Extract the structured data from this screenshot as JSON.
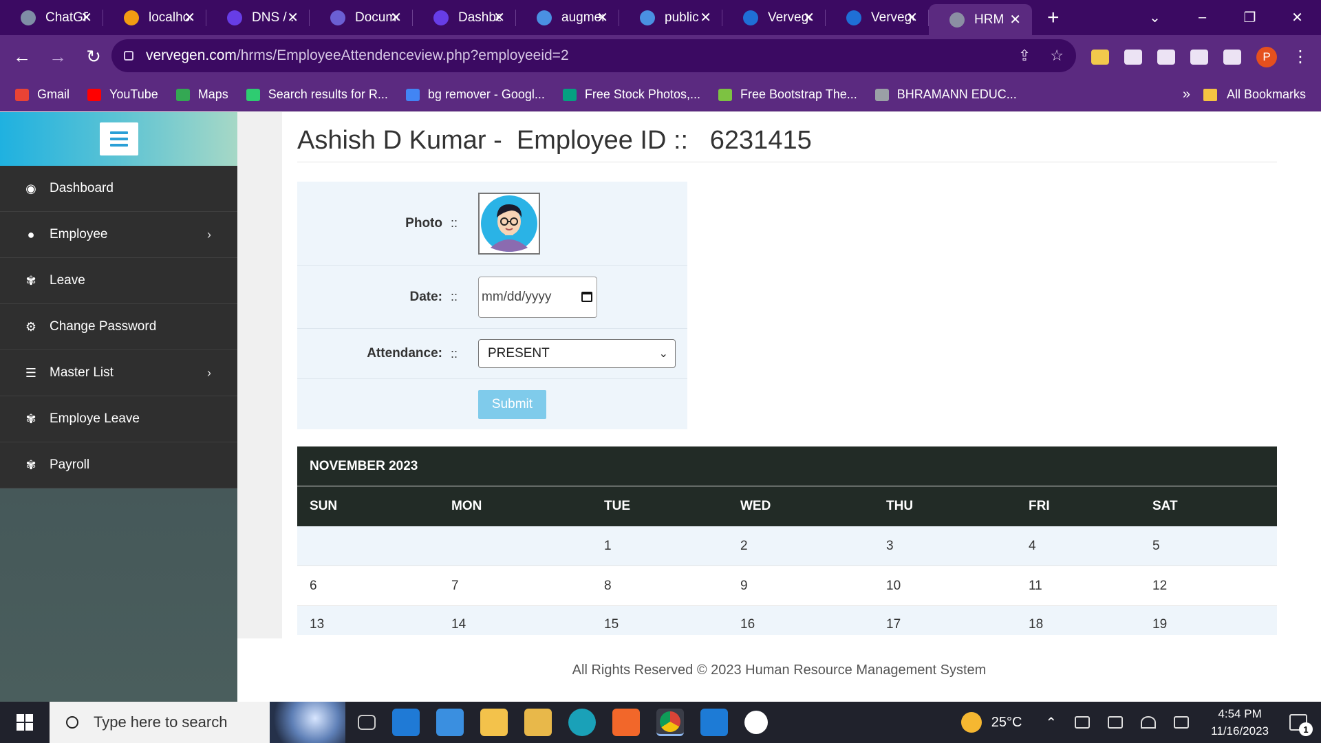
{
  "browser": {
    "tabs": [
      {
        "title": "ChatGPT",
        "icon": "chatgpt-icon",
        "color": "#7f8ea6"
      },
      {
        "title": "localhost",
        "icon": "xampp-icon",
        "color": "#f39c12"
      },
      {
        "title": "DNS / ...",
        "icon": "hostinger-icon",
        "color": "#673de6"
      },
      {
        "title": "Document",
        "icon": "docs-icon",
        "color": "#6b5fd3"
      },
      {
        "title": "Dashboard",
        "icon": "hostinger-icon",
        "color": "#673de6"
      },
      {
        "title": "augment",
        "icon": "globe-icon",
        "color": "#4a90e2"
      },
      {
        "title": "public",
        "icon": "globe-icon",
        "color": "#4a90e2"
      },
      {
        "title": "Vervegen",
        "icon": "vervegen-icon",
        "color": "#1f6fd6"
      },
      {
        "title": "Vervegen",
        "icon": "wordpress-icon",
        "color": "#1f6fd6"
      },
      {
        "title": "HRM",
        "icon": "globe-icon",
        "color": "#8b8fa3",
        "active": true
      }
    ],
    "url_host": "vervegen.com",
    "url_path": "/hrms/EmployeeAttendenceview.php?employeeid=2",
    "profile_initial": "P",
    "bookmarks": [
      {
        "label": "Gmail",
        "color": "#ea4335"
      },
      {
        "label": "YouTube",
        "color": "#ff0000"
      },
      {
        "label": "Maps",
        "color": "#34a853"
      },
      {
        "label": "Search results for R...",
        "color": "#2ecc71"
      },
      {
        "label": "bg remover - Googl...",
        "color": "#4285f4"
      },
      {
        "label": "Free Stock Photos,...",
        "color": "#05a081"
      },
      {
        "label": "Free Bootstrap The...",
        "color": "#7dc242"
      },
      {
        "label": "BHRAMANN EDUC...",
        "color": "#9aa0a6"
      }
    ],
    "bookmarks_more": "»",
    "all_bookmarks": "All Bookmarks"
  },
  "sidebar": {
    "items": [
      {
        "label": "Dashboard",
        "icon": "dashboard-icon",
        "glyph": "◉",
        "has_submenu": false
      },
      {
        "label": "Employee",
        "icon": "user-icon",
        "glyph": "●",
        "has_submenu": true
      },
      {
        "label": "Leave",
        "icon": "leaf-icon",
        "glyph": "✾",
        "has_submenu": false
      },
      {
        "label": "Change Password",
        "icon": "cogs-icon",
        "glyph": "⚙",
        "has_submenu": false
      },
      {
        "label": "Master List",
        "icon": "list-icon",
        "glyph": "☰",
        "has_submenu": true
      },
      {
        "label": "Employe Leave",
        "icon": "leaf-icon",
        "glyph": "✾",
        "has_submenu": false
      },
      {
        "label": "Payroll",
        "icon": "leaf-icon",
        "glyph": "✾",
        "has_submenu": false
      }
    ]
  },
  "main": {
    "employee_name": "Ashish D Kumar -",
    "employee_id_label": "Employee ID ::",
    "employee_id": "6231415",
    "form": {
      "photo_label": "Photo",
      "date_label": "Date:",
      "attendance_label": "Attendance:",
      "separator": "::",
      "date_placeholder": "mm/dd/yyyy",
      "attendance_value": "PRESENT",
      "submit_label": "Submit"
    },
    "calendar": {
      "month": "NOVEMBER 2023",
      "days": [
        "SUN",
        "MON",
        "TUE",
        "WED",
        "THU",
        "FRI",
        "SAT"
      ],
      "weeks": [
        [
          "",
          "",
          "1",
          "2",
          "3",
          "4",
          "5"
        ],
        [
          "6",
          "7",
          "8",
          "9",
          "10",
          "11",
          "12"
        ],
        [
          "13",
          "14",
          "15",
          "16",
          "17",
          "18",
          "19"
        ]
      ]
    },
    "footer": "All Rights Reserved © 2023 Human Resource Management System"
  },
  "taskbar": {
    "search_placeholder": "Type here to search",
    "temperature": "25°C",
    "time": "4:54 PM",
    "date": "11/16/2023",
    "notifications": "1"
  }
}
